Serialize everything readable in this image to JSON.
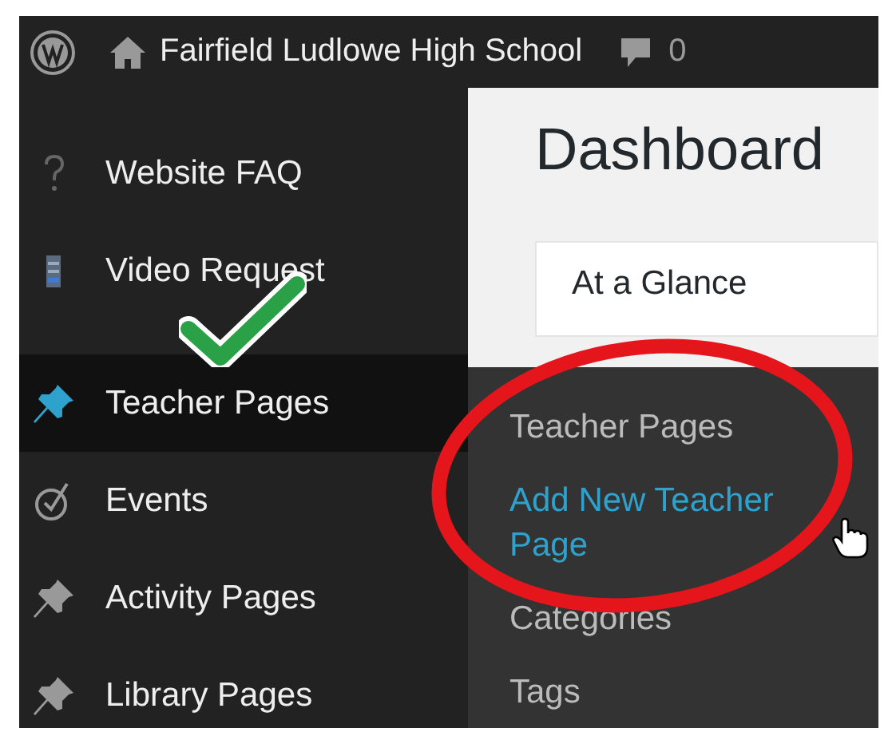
{
  "admin_bar": {
    "site_title": "Fairfield Ludlowe High School",
    "comment_count": "0"
  },
  "sidebar": {
    "items": [
      {
        "label": "Website FAQ",
        "kind": "question",
        "selected": false
      },
      {
        "label": "Video Request",
        "kind": "film",
        "selected": false
      },
      {
        "label": "Teacher Pages",
        "kind": "pin",
        "selected": true
      },
      {
        "label": "Events",
        "kind": "clock",
        "selected": false
      },
      {
        "label": "Activity Pages",
        "kind": "pin",
        "selected": false
      },
      {
        "label": "Library Pages",
        "kind": "pin",
        "selected": false
      }
    ]
  },
  "main": {
    "title": "Dashboard",
    "panel_title": "At a Glance"
  },
  "flyout": {
    "items": [
      {
        "label": "Teacher Pages",
        "selected": false
      },
      {
        "label": "Add New Teacher Page",
        "selected": true
      },
      {
        "label": "Categories",
        "selected": false
      },
      {
        "label": "Tags",
        "selected": false
      }
    ]
  },
  "annotations": [
    {
      "kind": "checkmark"
    },
    {
      "kind": "circle"
    },
    {
      "kind": "cursor"
    }
  ]
}
